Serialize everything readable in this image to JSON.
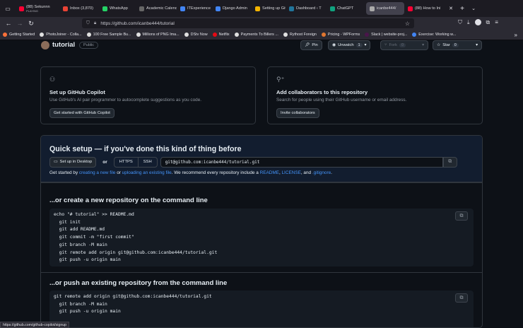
{
  "browser": {
    "tabs": [
      {
        "label": "(88) Sekunnn",
        "sub": "PLAYING",
        "color": "#ff0033"
      },
      {
        "label": "Inbox (3,870)",
        "color": "#ea4335"
      },
      {
        "label": "WhatsApp",
        "color": "#25d366"
      },
      {
        "label": "Academic Calendar",
        "color": "#666666"
      },
      {
        "label": "ITExperience",
        "color": "#4285f4"
      },
      {
        "label": "Django Admin",
        "color": "#4285f4"
      },
      {
        "label": "Setting up Git",
        "color": "#f4b400"
      },
      {
        "label": "Dashboard ‹ T",
        "color": "#21759b"
      },
      {
        "label": "ChatGPT",
        "color": "#10a37f"
      },
      {
        "label": "icanbe444/",
        "color": "#aaaaaa",
        "active": true
      },
      {
        "label": "(88) How to Ini",
        "color": "#ff0033"
      }
    ],
    "new_tab": "+",
    "url": "https://github.com/icanbe444/tutorial",
    "url_domain": "github.com",
    "bookmarks": [
      {
        "label": "Getting Started",
        "color": "#ff7139"
      },
      {
        "label": "PhotoJoiner - Colla...",
        "color": "#e0e0e0"
      },
      {
        "label": "100 Free Sample Bu...",
        "color": "#e0e0e0"
      },
      {
        "label": "Millions of PNG Ima...",
        "color": "#e0e0e0"
      },
      {
        "label": "DStv Now",
        "color": "#e0e0e0"
      },
      {
        "label": "Netflix",
        "color": "#e50914"
      },
      {
        "label": "Payments To Billers ...",
        "color": "#e0e0e0"
      },
      {
        "label": "Rythost Foreign",
        "color": "#e0e0e0"
      },
      {
        "label": "Pricing - WPForms",
        "color": "#e27730"
      },
      {
        "label": "Slack | website-proj...",
        "color": "#4a154b"
      },
      {
        "label": "Exercise: Working w...",
        "color": "#4285f4"
      }
    ],
    "status_url": "https://github.com/github-copilot/signup"
  },
  "repo": {
    "name": "tutorial",
    "visibility": "Public",
    "pin_label": "Pin",
    "unwatch_label": "Unwatch",
    "watch_count": "1",
    "fork_label": "Fork",
    "fork_count": "0",
    "star_label": "Star",
    "star_count": "0"
  },
  "copilot_card": {
    "title": "Set up GitHub Copilot",
    "desc": "Use GitHub's AI pair programmer to autocomplete suggestions as you code.",
    "button": "Get started with GitHub Copilot"
  },
  "collab_card": {
    "title": "Add collaborators to this repository",
    "desc": "Search for people using their GitHub username or email address.",
    "button": "Invite collaborators"
  },
  "quick_setup": {
    "title": "Quick setup — if you've done this kind of thing before",
    "desktop_btn": "Set up in Desktop",
    "or": "or",
    "https": "HTTPS",
    "ssh": "SSH",
    "clone_url": "git@github.com:icanbe444/tutorial.git",
    "hint_start": "Get started by ",
    "hint_link1": "creating a new file",
    "hint_or": " or ",
    "hint_link2": "uploading an existing file",
    "hint_mid": ". We recommend every repository include a ",
    "hint_readme": "README",
    "hint_comma": ", ",
    "hint_license": "LICENSE",
    "hint_and": ", and ",
    "hint_gitignore": ".gitignore",
    "hint_end": "."
  },
  "new_repo_section": {
    "title": "...or create a new repository on the command line",
    "code": "echo \"# tutorial\" >> README.md\n  git init\n  git add README.md\n  git commit -m \"first commit\"\n  git branch -M main\n  git remote add origin git@github.com:icanbe444/tutorial.git\n  git push -u origin main"
  },
  "push_section": {
    "title": "...or push an existing repository from the command line",
    "code": "git remote add origin git@github.com:icanbe444/tutorial.git\n  git branch -M main\n  git push -u origin main"
  }
}
